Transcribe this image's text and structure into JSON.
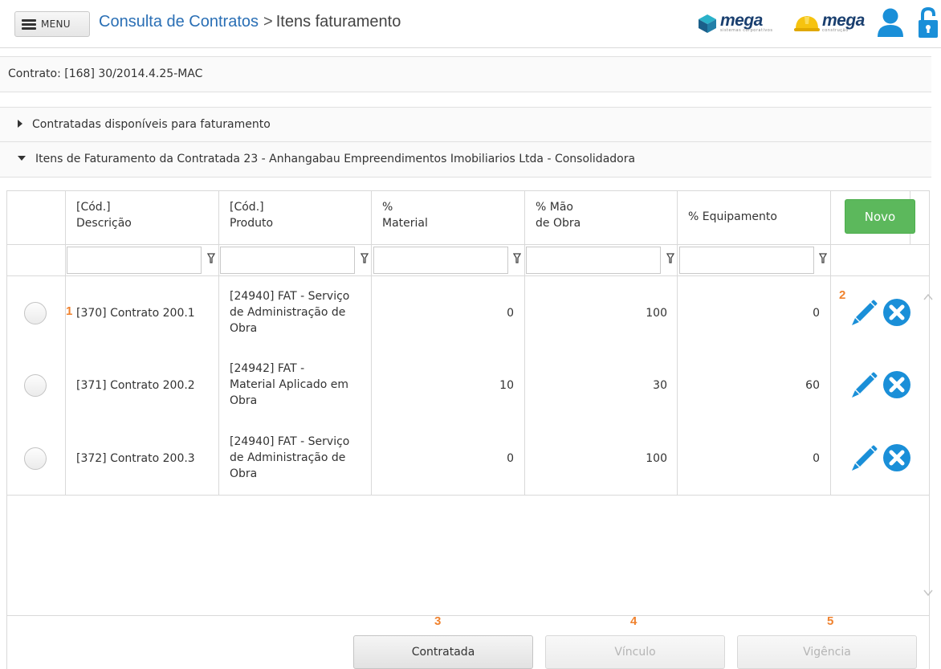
{
  "header": {
    "menu_label": "MENU",
    "breadcrumb_link": "Consulta de Contratos",
    "breadcrumb_sep": ">",
    "breadcrumb_current": "Itens faturamento",
    "logo1_text": "mega",
    "logo1_sub": "sistemas corporativos",
    "logo2_text": "mega",
    "logo2_sub": "construção"
  },
  "contract": {
    "label": "Contrato: [168] 30/2014.4.25-MAC"
  },
  "sections": [
    {
      "label": "Contratadas disponíveis para faturamento",
      "expanded": false
    },
    {
      "label": "Itens de Faturamento da Contratada 23 - Anhangabau Empreendimentos Imobiliarios Ltda - Consolidadora",
      "expanded": true
    }
  ],
  "grid": {
    "columns": [
      {
        "line1": "[Cód.]",
        "line2": "Descrição"
      },
      {
        "line1": "[Cód.]",
        "line2": "Produto"
      },
      {
        "line1": "%",
        "line2": "Material"
      },
      {
        "line1": "% Mão",
        "line2": "de Obra"
      },
      {
        "line1": "% Equipamento",
        "line2": ""
      }
    ],
    "new_button": "Novo",
    "rows": [
      {
        "descricao": "[370] Contrato 200.1",
        "produto_l1": "[24940] FAT - Serviço",
        "produto_l2": "de Administração de",
        "produto_l3": "Obra",
        "material": "0",
        "mao_obra": "100",
        "equipamento": "0"
      },
      {
        "descricao": "[371] Contrato 200.2",
        "produto_l1": "[24942] FAT -",
        "produto_l2": "Material Aplicado em",
        "produto_l3": "Obra",
        "material": "10",
        "mao_obra": "30",
        "equipamento": "60"
      },
      {
        "descricao": "[372] Contrato 200.3",
        "produto_l1": "[24940] FAT - Serviço",
        "produto_l2": "de Administração de",
        "produto_l3": "Obra",
        "material": "0",
        "mao_obra": "100",
        "equipamento": "0"
      }
    ]
  },
  "markers": {
    "m1": "1",
    "m2": "2",
    "m3": "3",
    "m4": "4",
    "m5": "5"
  },
  "footer": {
    "btn_contratada": "Contratada",
    "btn_vinculo": "Vínculo",
    "btn_vigencia": "Vigência"
  },
  "colors": {
    "accent_blue": "#1a8fd8",
    "link_blue": "#2a6fb5",
    "novo_green": "#5cb85c",
    "marker_orange": "#f0822e"
  }
}
